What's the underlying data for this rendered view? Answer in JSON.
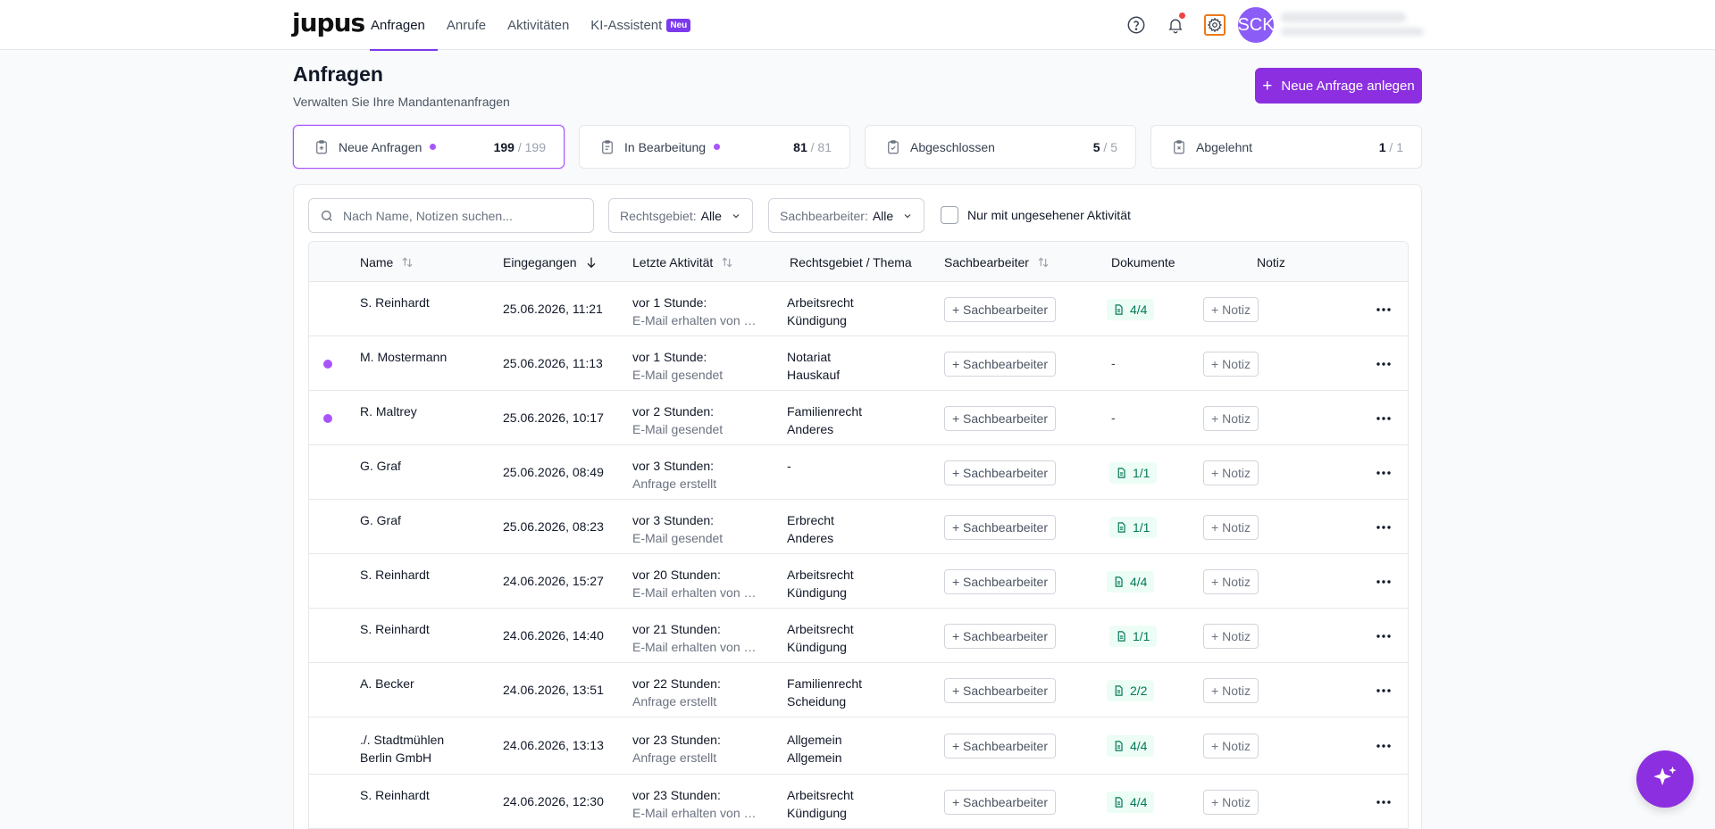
{
  "header": {
    "logo": "jupus",
    "nav": [
      {
        "label": "Anfragen",
        "active": true
      },
      {
        "label": "Anrufe",
        "active": false
      },
      {
        "label": "Aktivitäten",
        "active": false
      },
      {
        "label": "KI-Assistent",
        "active": false,
        "badge": "Neu"
      }
    ],
    "avatar": "SCK",
    "icons": [
      "help-icon",
      "bell-icon",
      "gear-icon"
    ]
  },
  "page": {
    "title": "Anfragen",
    "subtitle": "Verwalten Sie Ihre Mandantenanfragen",
    "primary_button": "Neue Anfrage anlegen"
  },
  "stats": [
    {
      "label": "Neue Anfragen",
      "value": "199",
      "total": "/ 199",
      "dot": true,
      "active": true
    },
    {
      "label": "In Bearbeitung",
      "value": "81",
      "total": "/ 81",
      "dot": true,
      "active": false
    },
    {
      "label": "Abgeschlossen",
      "value": "5",
      "total": "/ 5",
      "dot": false,
      "active": false
    },
    {
      "label": "Abgelehnt",
      "value": "1",
      "total": "/ 1",
      "dot": false,
      "active": false
    }
  ],
  "filters": {
    "search_placeholder": "Nach Name, Notizen suchen...",
    "rechtsgebiet_label": "Rechtsgebiet:",
    "rechtsgebiet_value": "Alle",
    "sachbearbeiter_label": "Sachbearbeiter:",
    "sachbearbeiter_value": "Alle",
    "checkbox_label": "Nur mit ungesehener Aktivität"
  },
  "table": {
    "columns": [
      "Name",
      "Eingegangen",
      "Letzte Aktivität",
      "Rechtsgebiet / Thema",
      "Sachbearbeiter",
      "Dokumente",
      "Notiz"
    ],
    "assign_label": "+ Sachbearbeiter",
    "note_label": "+ Notiz",
    "rows": [
      {
        "name": [
          "S. Reinhardt"
        ],
        "date": "25.06.2026, 11:21",
        "activity": "vor 1 Stunde:",
        "activity_detail": "E-Mail erhalten von …",
        "area": "Arbeitsrecht",
        "topic": "Kündigung",
        "docs": "4/4",
        "unseen": false
      },
      {
        "name": [
          "M. Mostermann"
        ],
        "date": "25.06.2026, 11:13",
        "activity": "vor 1 Stunde:",
        "activity_detail": "E-Mail gesendet",
        "area": "Notariat",
        "topic": "Hauskauf",
        "docs": "-",
        "unseen": true
      },
      {
        "name": [
          "R. Maltrey"
        ],
        "date": "25.06.2026, 10:17",
        "activity": "vor 2 Stunden:",
        "activity_detail": "E-Mail gesendet",
        "area": "Familienrecht",
        "topic": "Anderes",
        "docs": "-",
        "unseen": true
      },
      {
        "name": [
          "G. Graf"
        ],
        "date": "25.06.2026, 08:49",
        "activity": "vor 3 Stunden:",
        "activity_detail": "Anfrage erstellt",
        "area": "-",
        "topic": "",
        "docs": "1/1",
        "unseen": false
      },
      {
        "name": [
          "G. Graf"
        ],
        "date": "25.06.2026, 08:23",
        "activity": "vor 3 Stunden:",
        "activity_detail": "E-Mail gesendet",
        "area": "Erbrecht",
        "topic": "Anderes",
        "docs": "1/1",
        "unseen": false
      },
      {
        "name": [
          "S. Reinhardt"
        ],
        "date": "24.06.2026, 15:27",
        "activity": "vor 20 Stunden:",
        "activity_detail": "E-Mail erhalten von …",
        "area": "Arbeitsrecht",
        "topic": "Kündigung",
        "docs": "4/4",
        "unseen": false
      },
      {
        "name": [
          "S. Reinhardt"
        ],
        "date": "24.06.2026, 14:40",
        "activity": "vor 21 Stunden:",
        "activity_detail": "E-Mail erhalten von …",
        "area": "Arbeitsrecht",
        "topic": "Kündigung",
        "docs": "1/1",
        "unseen": false
      },
      {
        "name": [
          "A. Becker"
        ],
        "date": "24.06.2026, 13:51",
        "activity": "vor 22 Stunden:",
        "activity_detail": "Anfrage erstellt",
        "area": "Familienrecht",
        "topic": "Scheidung",
        "docs": "2/2",
        "unseen": false
      },
      {
        "name": [
          "./. Stadtmühlen",
          "Berlin GmbH"
        ],
        "date": "24.06.2026, 13:13",
        "activity": "vor 23 Stunden:",
        "activity_detail": "Anfrage erstellt",
        "area": "Allgemein",
        "topic": "Allgemein",
        "docs": "4/4",
        "unseen": false
      },
      {
        "name": [
          "S. Reinhardt"
        ],
        "date": "24.06.2026, 12:30",
        "activity": "vor 23 Stunden:",
        "activity_detail": "E-Mail erhalten von …",
        "area": "Arbeitsrecht",
        "topic": "Kündigung",
        "docs": "4/4",
        "unseen": false
      }
    ]
  },
  "colors": {
    "accent": "#8b2fe0",
    "unseen_dot": "#a855f7",
    "doc_badge_bg": "#ecfdf5",
    "doc_badge_fg": "#047857",
    "notification": "#ef4444"
  }
}
